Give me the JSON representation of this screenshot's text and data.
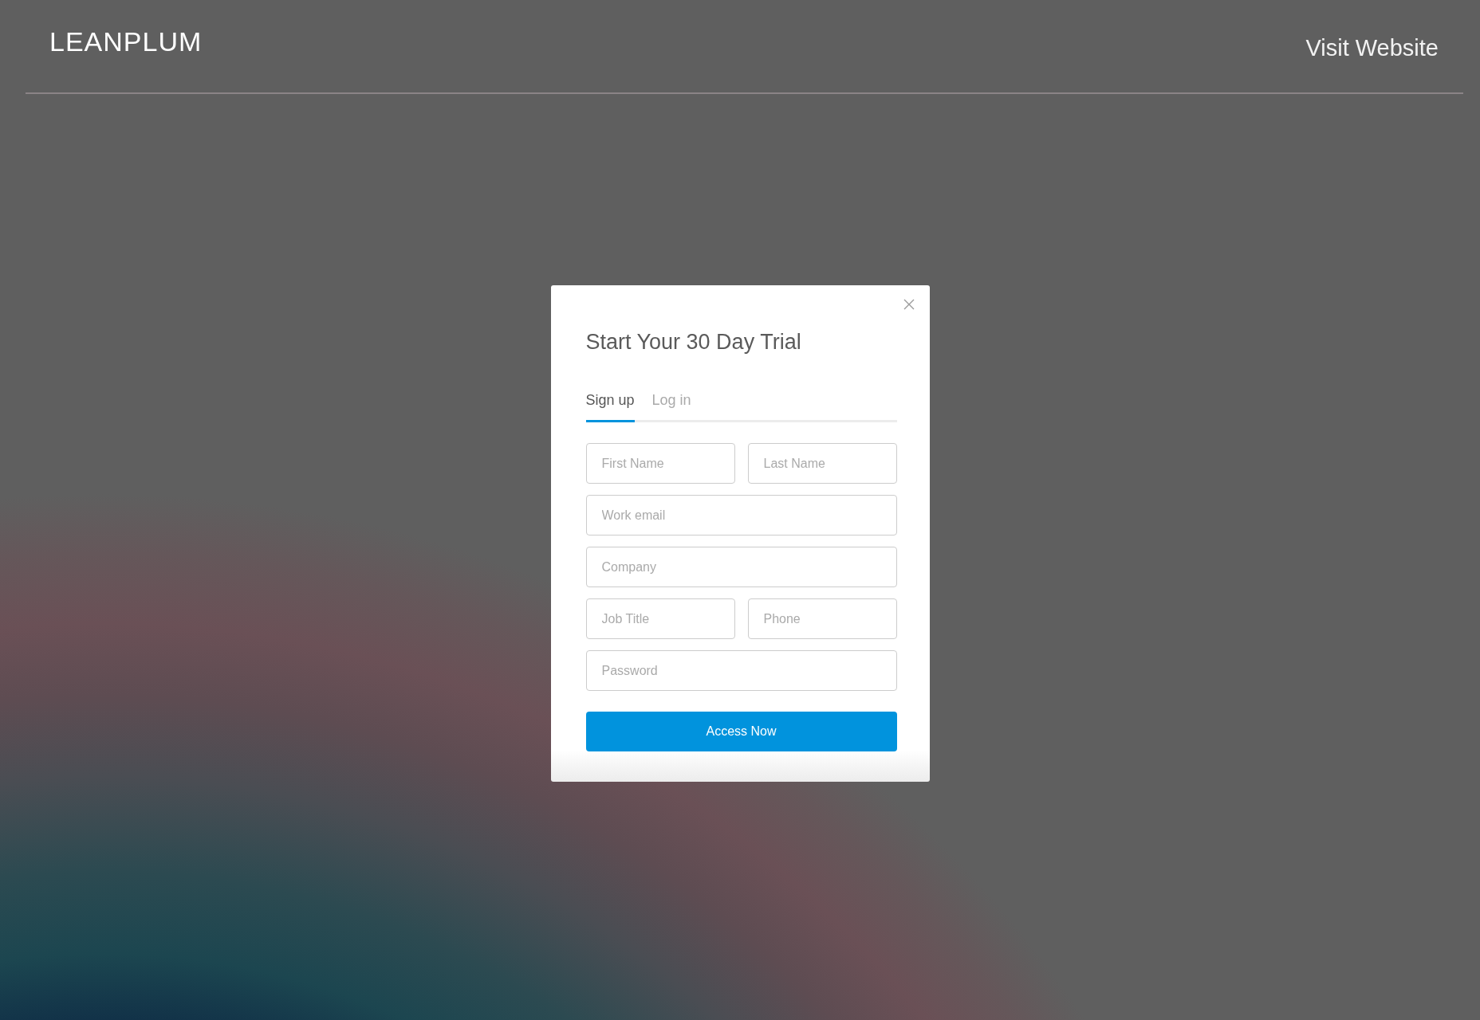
{
  "header": {
    "logo": "LEANPLUM",
    "link": "Visit Website"
  },
  "dialog": {
    "title": "Start Your 30 Day Trial",
    "tabs": [
      {
        "label": "Sign up",
        "selected": true
      },
      {
        "label": "Log in",
        "selected": false
      }
    ],
    "field_rows": [
      [
        {
          "placeholder": "First Name"
        },
        {
          "placeholder": "Last Name"
        }
      ],
      [
        {
          "placeholder": "Work email"
        }
      ],
      [
        {
          "placeholder": "Company"
        }
      ],
      [
        {
          "placeholder": "Job Title"
        },
        {
          "placeholder": "Phone"
        }
      ],
      [
        {
          "placeholder": "Password"
        }
      ]
    ],
    "submit": "Access Now"
  }
}
